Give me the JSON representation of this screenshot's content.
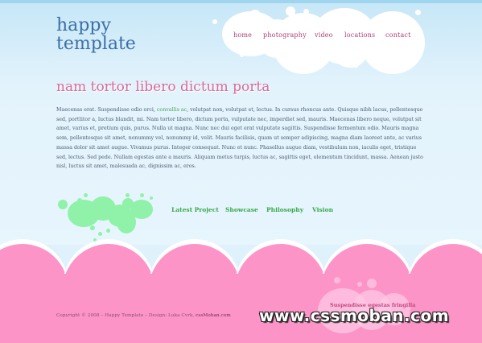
{
  "logo": {
    "line1": "happy",
    "line2": "template"
  },
  "nav": [
    "home",
    "photography",
    "video",
    "locations",
    "contact"
  ],
  "headline": "nam tortor libero dictum porta",
  "paragraph": {
    "p1": "Maecenas erat. Suspendisse odio orci, ",
    "link1": "convallis ac",
    "p2": ", volutpat non, volutpat et, lectus. In cursus rhoncus ante. Quisque nibh lacus, pellentesque sed, porttitor a, luctus blandit, mi. Nam tortor libero, dictum porta, vulputate nec, imperdiet sed, mauris. Maecenas libero neque, volutpat sit amet, varius et, pretium quis, purus. Nulla ut magna. Nunc nec dui eget erat vulputate sagittis. Suspendisse fermentum odio. Mauris magna sem, pellentesque sit amet, nonummy vel, nonummy id, velit. Mauris facilisis, quam ut semper adipiscing, magna diam laoreet ante, ac varius massa dolor sit amet augue. Vivamus purus. Integer consequat. Nunc et nunc. Phasellus augue diam, vestibulum non, iaculis eget, tristique sed, lectus. Sed pede. Nullam egestas ante a mauris. Aliquam metus turpis, luctus ac, sagittis eget, elementum tincidunt, massa. Aenean justo nisl, luctus sit amet, malesuada ac, dignissim ac, eros."
  },
  "sublinks": [
    "Latest Project",
    "Showcase",
    "Philosophy",
    "Vision"
  ],
  "footer": {
    "copyright": "Copyright © 2008 – Happy Template – Design: Luka Cvrk, ",
    "credit": "cssMoban.com",
    "news": "Suspendisse egestas fringilla"
  },
  "watermark": "www.cssmoban.com",
  "colors": {
    "pink": "#fd94c8",
    "sky": "#dff1fb",
    "green": "#8ff2a8",
    "nav": "#b03d73"
  }
}
